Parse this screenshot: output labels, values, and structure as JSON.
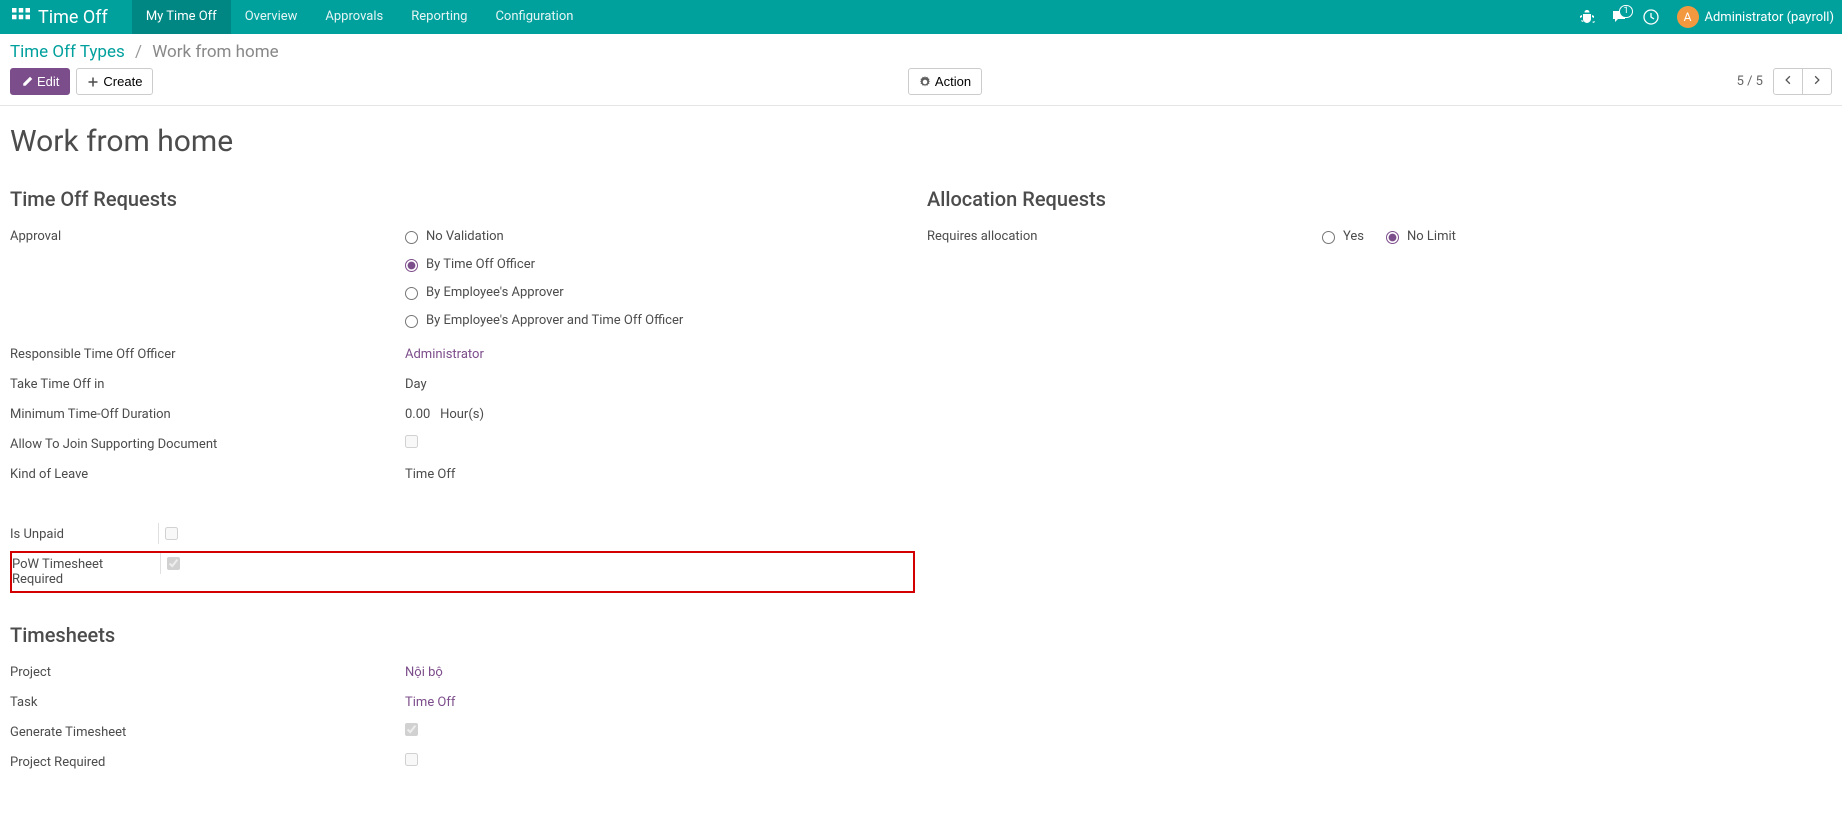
{
  "header": {
    "app_title": "Time Off",
    "nav": [
      "My Time Off",
      "Overview",
      "Approvals",
      "Reporting",
      "Configuration"
    ],
    "active_nav": 0,
    "conversations_badge": "1",
    "user_avatar_letter": "A",
    "user_name": "Administrator (payroll)"
  },
  "breadcrumb": {
    "parent": "Time Off Types",
    "current": "Work from home"
  },
  "buttons": {
    "edit": "Edit",
    "create": "Create",
    "action": "Action"
  },
  "pager": {
    "text": "5 / 5"
  },
  "page_title": "Work from home",
  "sections": {
    "timeoff_requests": {
      "title": "Time Off Requests",
      "approval_label": "Approval",
      "approval_options": [
        "No Validation",
        "By Time Off Officer",
        "By Employee's Approver",
        "By Employee's Approver and Time Off Officer"
      ],
      "approval_selected": 1,
      "responsible_label": "Responsible Time Off Officer",
      "responsible_value": "Administrator",
      "take_in_label": "Take Time Off in",
      "take_in_value": "Day",
      "min_duration_label": "Minimum Time-Off Duration",
      "min_duration_value": "0.00",
      "min_duration_unit": "Hour(s)",
      "allow_doc_label": "Allow To Join Supporting Document",
      "allow_doc_checked": false,
      "kind_label": "Kind of Leave",
      "kind_value": "Time Off"
    },
    "allocation": {
      "title": "Allocation Requests",
      "requires_label": "Requires allocation",
      "options": [
        "Yes",
        "No Limit"
      ],
      "selected": 1
    },
    "flags": {
      "is_unpaid_label": "Is Unpaid",
      "is_unpaid_checked": false,
      "pow_label": "PoW Timesheet Required",
      "pow_checked": true
    },
    "timesheets": {
      "title": "Timesheets",
      "project_label": "Project",
      "project_value": "Nội bộ",
      "task_label": "Task",
      "task_value": "Time Off",
      "generate_label": "Generate Timesheet",
      "generate_checked": true,
      "project_required_label": "Project Required",
      "project_required_checked": false
    }
  }
}
